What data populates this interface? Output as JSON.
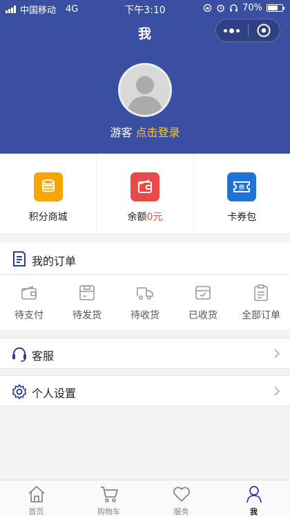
{
  "status_bar": {
    "carrier": "中国移动",
    "network": "4G",
    "time": "下午3:10",
    "battery_text": "70%",
    "battery_level": 0.7
  },
  "nav": {
    "title": "我"
  },
  "user": {
    "name": "游客",
    "login_link": "点击登录"
  },
  "shortcuts": [
    {
      "label": "积分商城",
      "icon": "coins-icon",
      "color": "#f5a700"
    },
    {
      "label_prefix": "余额",
      "value": "0元",
      "icon": "wallet-icon",
      "color": "#e84a4a"
    },
    {
      "label": "卡券包",
      "icon": "coupon-icon",
      "color": "#1e73d6"
    }
  ],
  "orders": {
    "title": "我的订单",
    "items": [
      {
        "label": "待支付",
        "icon": "wallet-outline-icon"
      },
      {
        "label": "待发货",
        "icon": "package-icon"
      },
      {
        "label": "待收货",
        "icon": "truck-icon"
      },
      {
        "label": "已收货",
        "icon": "received-box-icon"
      },
      {
        "label": "全部订单",
        "icon": "clipboard-icon"
      }
    ]
  },
  "menu": {
    "service": "客服",
    "settings": "个人设置"
  },
  "tabbar": [
    {
      "label": "首页",
      "icon": "home-icon",
      "active": false
    },
    {
      "label": "购物车",
      "icon": "cart-icon",
      "active": false
    },
    {
      "label": "服务",
      "icon": "heart-icon",
      "active": false
    },
    {
      "label": "我",
      "icon": "person-icon",
      "active": true
    }
  ],
  "colors": {
    "header_bg": "#3a4fa2",
    "login_link": "#f5c542",
    "accent_red": "#e74c3c",
    "icon_blue": "#2b3f8f"
  }
}
